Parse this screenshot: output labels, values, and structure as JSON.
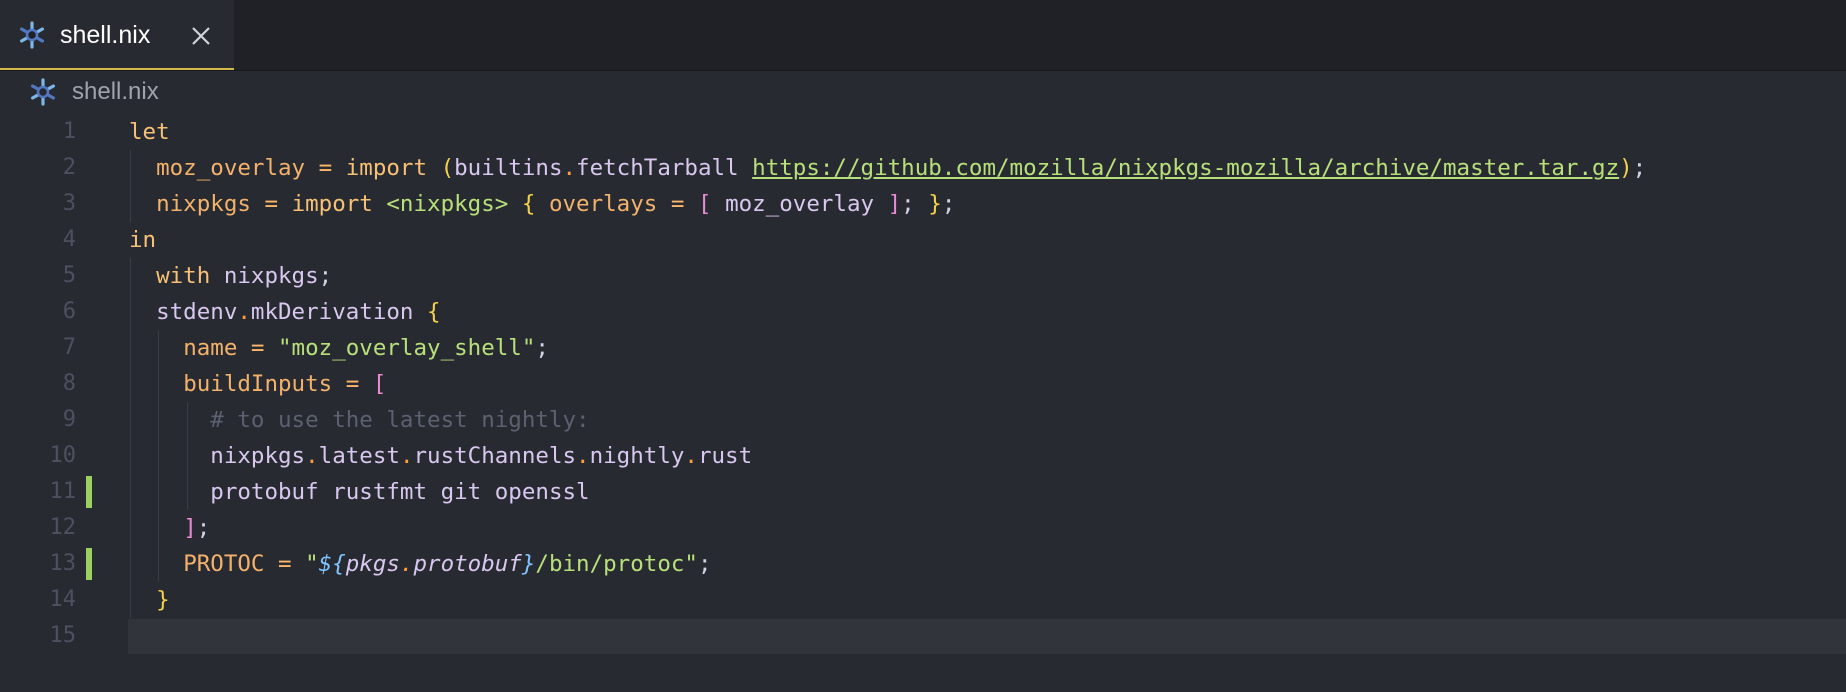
{
  "tab": {
    "label": "shell.nix",
    "icon": "nix-snowflake-icon",
    "close_icon": "close-icon",
    "active_color": "#d4b84a"
  },
  "breadcrumb": {
    "label": "shell.nix",
    "icon": "nix-snowflake-icon"
  },
  "editor": {
    "current_line": 15,
    "modified_lines": [
      11,
      13
    ],
    "modified_color": "#9bcf62",
    "line_numbers": [
      "1",
      "2",
      "3",
      "4",
      "5",
      "6",
      "7",
      "8",
      "9",
      "10",
      "11",
      "12",
      "13",
      "14",
      "15"
    ],
    "lines": [
      "let",
      "  moz_overlay = import (builtins.fetchTarball https://github.com/mozilla/nixpkgs-mozilla/archive/master.tar.gz);",
      "  nixpkgs = import <nixpkgs> { overlays = [ moz_overlay ]; };",
      "in",
      "  with nixpkgs;",
      "  stdenv.mkDerivation {",
      "    name = \"moz_overlay_shell\";",
      "    buildInputs = [",
      "      # to use the latest nightly:",
      "      nixpkgs.latest.rustChannels.nightly.rust",
      "      protobuf rustfmt git openssl",
      "    ];",
      "    PROTOC = \"${pkgs.protobuf}/bin/protoc\";",
      "  }",
      ""
    ]
  }
}
